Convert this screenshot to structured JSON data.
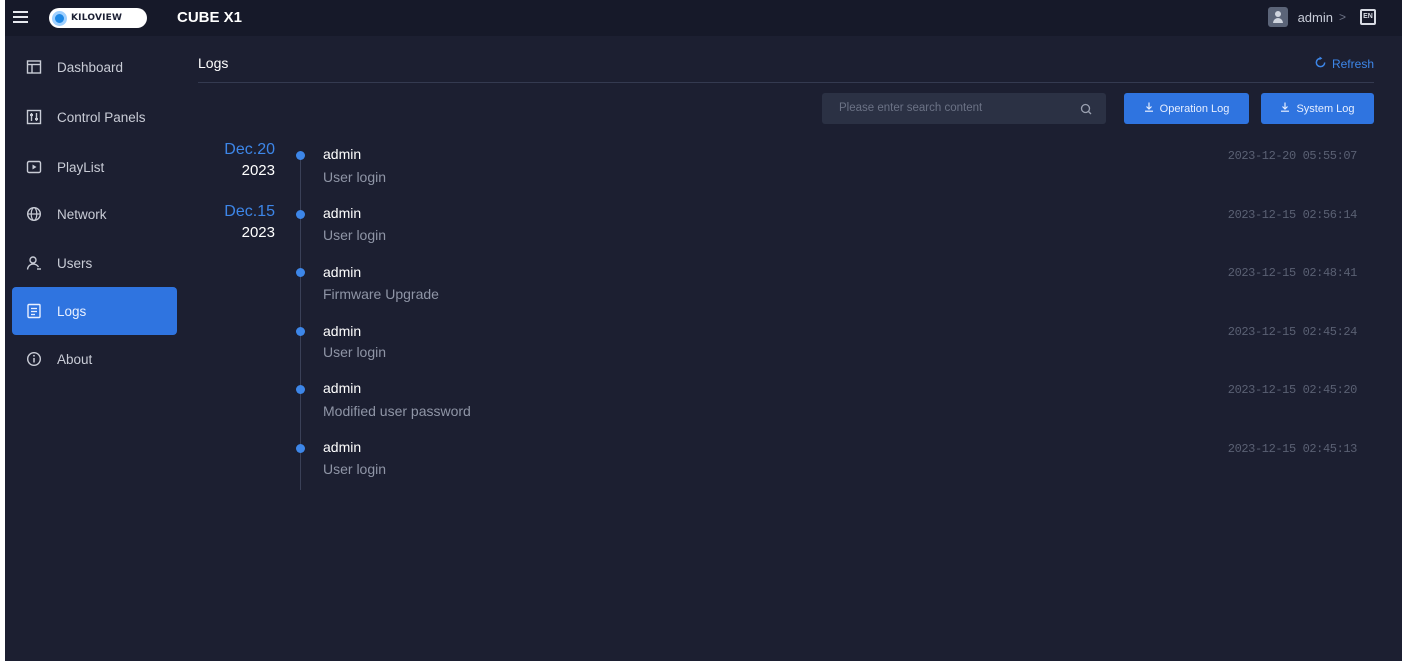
{
  "topbar": {
    "logo_text": "KILOVIEW",
    "product": "CUBE X1",
    "user_name": "admin",
    "user_chevron": ">",
    "lang": "EN"
  },
  "sidebar": {
    "items": [
      {
        "label": "Dashboard",
        "icon": "dashboard-icon",
        "active": false
      },
      {
        "label": "Control Panels",
        "icon": "control-panels-icon",
        "active": false
      },
      {
        "label": "PlayList",
        "icon": "playlist-icon",
        "active": false
      },
      {
        "label": "Network",
        "icon": "network-icon",
        "active": false
      },
      {
        "label": "Users",
        "icon": "users-icon",
        "active": false
      },
      {
        "label": "Logs",
        "icon": "logs-icon",
        "active": true
      },
      {
        "label": "About",
        "icon": "about-icon",
        "active": false
      }
    ]
  },
  "main": {
    "title": "Logs",
    "refresh_label": "Refresh",
    "search_placeholder": "Please enter search content",
    "operation_log_label": "Operation Log",
    "system_log_label": "System Log",
    "dates": [
      {
        "month_day": "Dec.20",
        "year": "2023"
      },
      {
        "month_day": "Dec.15",
        "year": "2023"
      }
    ],
    "logs": [
      {
        "user": "admin",
        "action": "User login",
        "time": "2023-12-20 05:55:07"
      },
      {
        "user": "admin",
        "action": "User login",
        "time": "2023-12-15 02:56:14"
      },
      {
        "user": "admin",
        "action": "Firmware Upgrade",
        "time": "2023-12-15 02:48:41"
      },
      {
        "user": "admin",
        "action": "User login",
        "time": "2023-12-15 02:45:24"
      },
      {
        "user": "admin",
        "action": "Modified user password",
        "time": "2023-12-15 02:45:20"
      },
      {
        "user": "admin",
        "action": "User login",
        "time": "2023-12-15 02:45:13"
      }
    ]
  },
  "colors": {
    "background": "#1c1f31",
    "topbar": "#161929",
    "accent": "#2f74e0",
    "link": "#3d86e8"
  }
}
